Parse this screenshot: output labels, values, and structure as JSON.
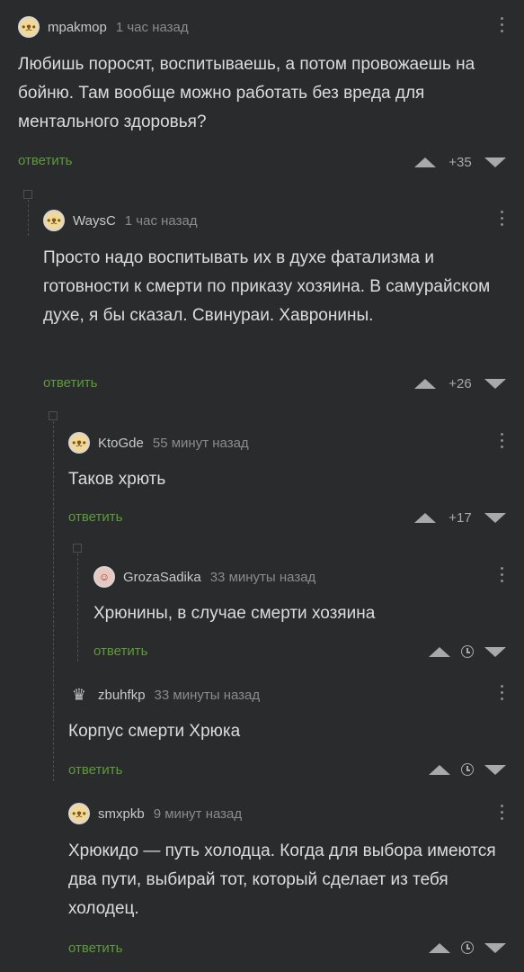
{
  "comments": [
    {
      "user": "mpakmop",
      "time": "1 час назад",
      "text": "Любишь поросят, воспитываешь, а потом провожаешь на бойню. Там вообще можно работать без вреда для ментального здоровья?",
      "reply": "ответить",
      "score": "+35",
      "avatar_icon": "bunny-avatar-icon"
    },
    {
      "user": "WaysC",
      "time": "1 час назад",
      "text": "Просто надо воспитывать их в духе фатализма и готовности к смерти по приказу хозяина. В самурайском духе, я бы сказал. Свинураи. Хавронины.",
      "reply": "ответить",
      "score": "+26",
      "avatar_icon": "bunny-avatar-icon"
    },
    {
      "user": "KtoGde",
      "time": "55 минут назад",
      "text": "Таков хрють",
      "reply": "ответить",
      "score": "+17",
      "avatar_icon": "bunny-avatar-icon"
    },
    {
      "user": "GrozaSadika",
      "time": "33 минуты назад",
      "text": "Хрюнины, в случае смерти хозяина",
      "reply": "ответить",
      "score": "",
      "avatar_icon": "photo-avatar-icon"
    },
    {
      "user": "zbuhfkp",
      "time": "33 минуты назад",
      "text": "Корпус смерти Хрюка",
      "reply": "ответить",
      "score": "",
      "avatar_icon": "emblem-avatar-icon"
    },
    {
      "user": "smxpkb",
      "time": "9 минут назад",
      "text": "Хрюкидо — путь холодца. Когда для выбора имеются два пути, выбирай тот, который сделает из тебя холодец.",
      "reply": "ответить",
      "score": "",
      "avatar_icon": "bunny-avatar-icon"
    }
  ],
  "colors": {
    "background": "#2a2b2d",
    "reply_link": "#5e9a3a",
    "muted": "#8b8b8b"
  }
}
